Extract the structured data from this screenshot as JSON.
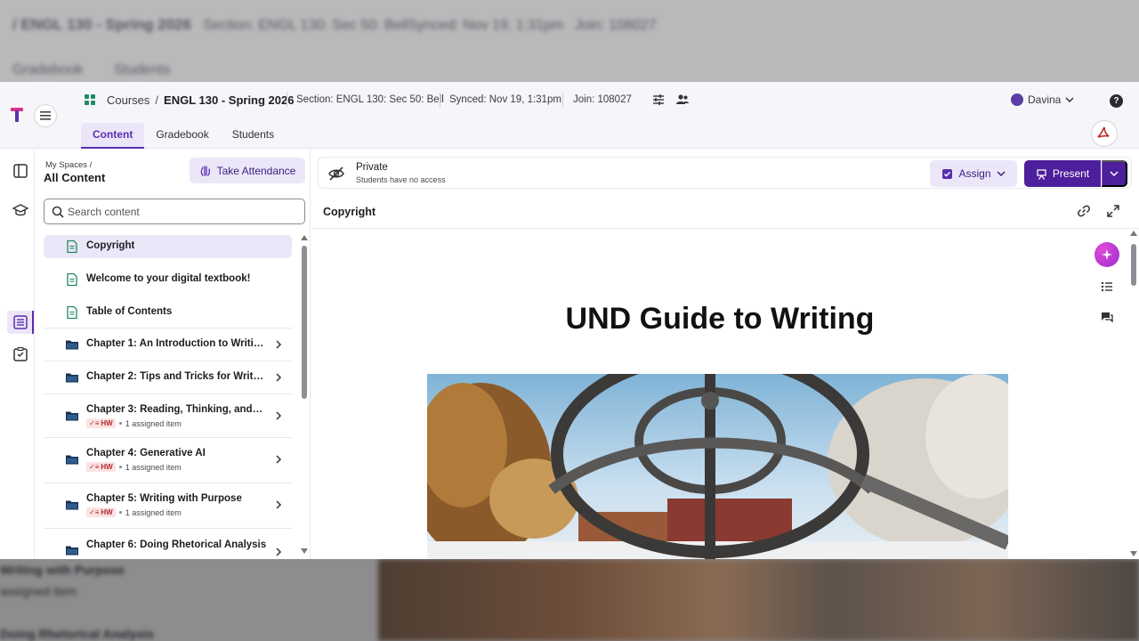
{
  "backdrop": {
    "top_title": "/ ENGL 130 - Spring 2026",
    "top_section": "Section: ENGL 130: Sec 50: Bell",
    "top_synced": "Synced: Nov 19, 1:31pm",
    "top_join": "Join: 108027",
    "top_tab1": "Gradebook",
    "top_tab2": "Students",
    "bottom_text1": "Writing with Purpose",
    "bottom_text2": "assigned item",
    "bottom_text3": "Doing Rhetorical Analysis"
  },
  "header": {
    "breadcrumb_root": "Courses",
    "breadcrumb_sep": "/",
    "breadcrumb_current": "ENGL 130 - Spring 2026",
    "section": "Section: ENGL 130: Sec 50: Bell",
    "synced": "Synced: Nov 19, 1:31pm",
    "join": "Join: 108027",
    "user_name": "Davina",
    "help": "?",
    "tabs": [
      {
        "label": "Content",
        "active": true
      },
      {
        "label": "Gradebook",
        "active": false
      },
      {
        "label": "Students",
        "active": false
      }
    ]
  },
  "rail": {
    "icons": [
      "sidebar-toggle-icon",
      "graduation-cap-icon",
      "list-icon",
      "checklist-icon"
    ]
  },
  "sidebar": {
    "space_label": "My Spaces /",
    "space_title": "All Content",
    "attendance_label": "Take Attendance",
    "search_placeholder": "Search content",
    "items": [
      {
        "title": "Copyright",
        "type": "page",
        "selected": true
      },
      {
        "title": "Welcome to your digital textbook!",
        "type": "page"
      },
      {
        "title": "Table of Contents",
        "type": "page"
      },
      {
        "title": "Chapter 1: An Introduction to Writing ...",
        "type": "folder"
      },
      {
        "title": "Chapter 2: Tips and Tricks for Writing ...",
        "type": "folder"
      },
      {
        "title": "Chapter 3: Reading, Thinking, and Wr...",
        "type": "folder",
        "badge": "HW",
        "assigned": "1 assigned item"
      },
      {
        "title": "Chapter 4: Generative AI",
        "type": "folder",
        "badge": "HW",
        "assigned": "1 assigned item"
      },
      {
        "title": "Chapter 5: Writing with Purpose",
        "type": "folder",
        "badge": "HW",
        "assigned": "1 assigned item"
      },
      {
        "title": "Chapter 6: Doing Rhetorical Analysis",
        "type": "folder"
      }
    ]
  },
  "main": {
    "privacy_title": "Private",
    "privacy_sub": "Students have no access",
    "assign_label": "Assign",
    "present_label": "Present",
    "doc_title": "Copyright",
    "book_title": "UND Guide to Writing"
  },
  "colors": {
    "accent": "#4d1f9c",
    "accent_light": "#ece7f8",
    "hw_badge": "#b52a2a"
  }
}
